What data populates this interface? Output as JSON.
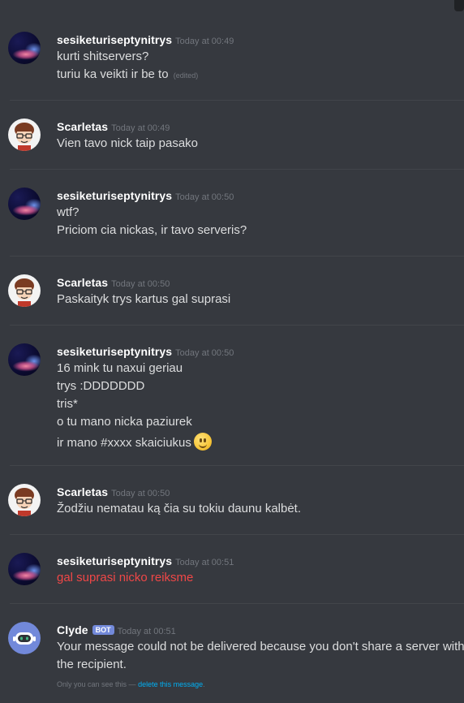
{
  "messages": [
    {
      "author": "sesiketuriseptynitrys",
      "timestamp": "Today at 00:49",
      "lines": [
        "kurti shitservers?",
        "turiu ka veikti ir be to"
      ],
      "edited_label": "(edited)"
    },
    {
      "author": "Scarletas",
      "timestamp": "Today at 00:49",
      "lines": [
        "Vien tavo nick taip pasako"
      ]
    },
    {
      "author": "sesiketuriseptynitrys",
      "timestamp": "Today at 00:50",
      "lines": [
        "wtf?",
        "Priciom cia nickas, ir tavo serveris?"
      ]
    },
    {
      "author": "Scarletas",
      "timestamp": "Today at 00:50",
      "lines": [
        "Paskaityk trys kartus gal suprasi"
      ]
    },
    {
      "author": "sesiketuriseptynitrys",
      "timestamp": "Today at 00:50",
      "lines": [
        "16 mink tu naxui geriau",
        "trys :DDDDDDD",
        "tris*",
        "o tu mano nicka paziurek",
        "ir mano #xxxx skaiciukus"
      ],
      "emoji": "slight-smile-emoji"
    },
    {
      "author": "Scarletas",
      "timestamp": "Today at 00:50",
      "lines": [
        "Žodžiu nematau ką čia su tokiu daunu kalbėt."
      ]
    },
    {
      "author": "sesiketuriseptynitrys",
      "timestamp": "Today at 00:51",
      "lines": [
        "gal suprasi nicko reiksme"
      ],
      "failed": true
    },
    {
      "author": "Clyde",
      "bot_tag": "BOT",
      "timestamp": "Today at 00:51",
      "lines": [
        "Your message could not be delivered because you don't share a server with",
        "the recipient."
      ],
      "note_prefix": "Only you can see this —",
      "note_link": "delete this message",
      "note_suffix": "."
    }
  ],
  "colors": {
    "background": "#36393f",
    "username": "#ffffff",
    "timestamp": "#72767d",
    "message_text": "#dcddde",
    "failed_text": "#f04747",
    "bot_tag": "#7289da",
    "link": "#00b0f4"
  }
}
